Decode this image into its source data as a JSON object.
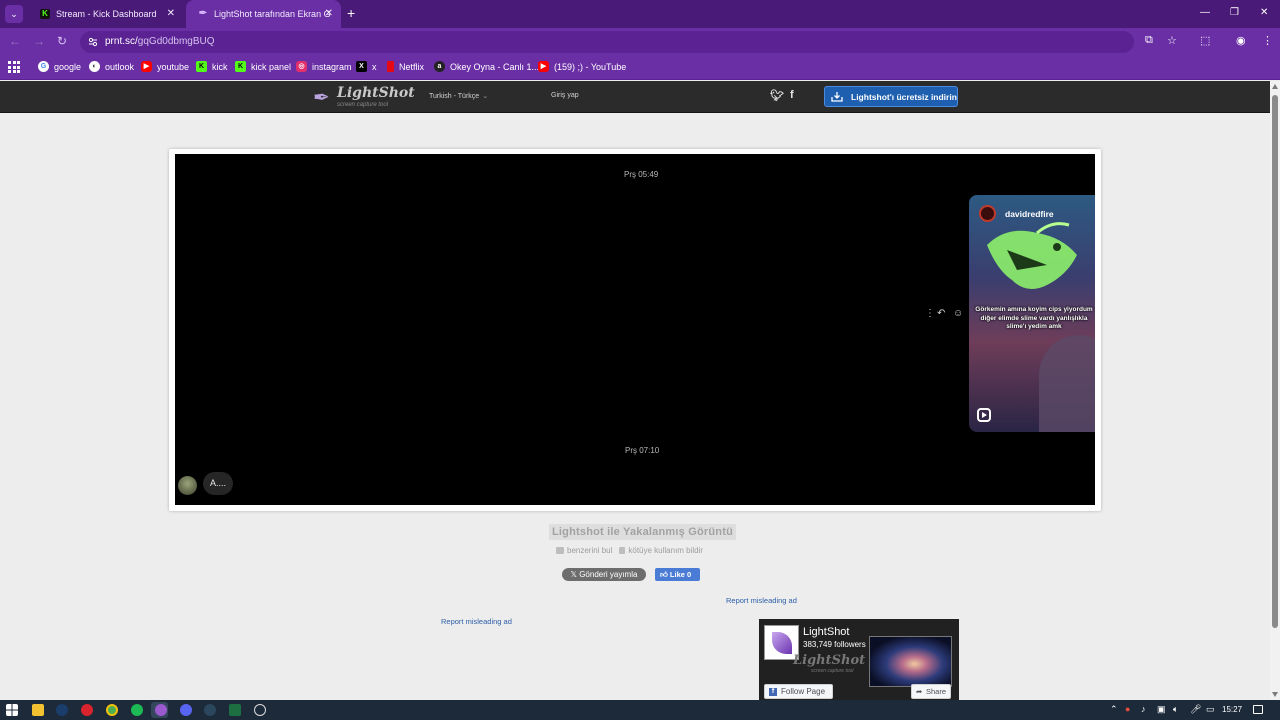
{
  "browser": {
    "tabs": [
      {
        "title": "Stream - Kick Dashboard",
        "favicon": "kick-icon",
        "active": false
      },
      {
        "title": "LightShot tarafından Ekran Görüntüsü",
        "favicon": "lightshot-icon",
        "active": true
      }
    ],
    "url": {
      "host": "prnt.sc/",
      "path": "gqGd0dbmgBUQ"
    },
    "bookmarks": [
      {
        "label": "google",
        "icon": "google-icon",
        "color": "#ffffff"
      },
      {
        "label": "outlook",
        "icon": "outlook-icon",
        "color": "#ffffff"
      },
      {
        "label": "youtube",
        "icon": "youtube-icon",
        "color": "#ff0000"
      },
      {
        "label": "kick",
        "icon": "kick-icon",
        "color": "#53fc18"
      },
      {
        "label": "kick panel",
        "icon": "kick-icon",
        "color": "#53fc18"
      },
      {
        "label": "instagram",
        "icon": "instagram-icon",
        "color": "#e1306c"
      },
      {
        "label": "x",
        "icon": "x-icon",
        "color": "#000000"
      },
      {
        "label": "Netflix",
        "icon": "netflix-icon",
        "color": "#e50914"
      },
      {
        "label": "Okey Oyna - Canlı 1...",
        "icon": "okey-icon",
        "color": "#222222"
      },
      {
        "label": "(159) ;) - YouTube",
        "icon": "youtube-icon",
        "color": "#ff0000"
      }
    ]
  },
  "lightshot": {
    "logo_name": "LightShot",
    "logo_tagline": "screen capture tool",
    "language": "Turkish - Türkçe",
    "login": "Giriş yap",
    "download_button": "Lightshot'ı ücretsiz indirin",
    "screenshot": {
      "time_top": "Prş 05:49",
      "time_bottom": "Prş 07:10",
      "message_text": "A....",
      "reel_user": "davidredfire",
      "reel_caption": "Görkemin amına koyim cips yiyordum diğer elimde slime vardı yanlışlıkla slime'ı yedim amk"
    },
    "image_title": "Lightshot ile Yakalanmış Görüntü",
    "find_similar": "benzerini bul",
    "report_abuse": "kötüye kullanım bildir",
    "tweet_button": "Gönderi yayımla",
    "like_button": "Like 0",
    "report_ad_1": "Report misleading ad",
    "report_ad_2": "Report misleading ad",
    "fb": {
      "page_name": "LightShot",
      "followers": "383,749 followers",
      "follow_button": "Follow Page",
      "share_button": "Share",
      "watermark": "LightShot",
      "watermark_sub": "screen capture tool"
    }
  },
  "taskbar": {
    "time": "15:27",
    "accent": "#1d2a3a"
  }
}
